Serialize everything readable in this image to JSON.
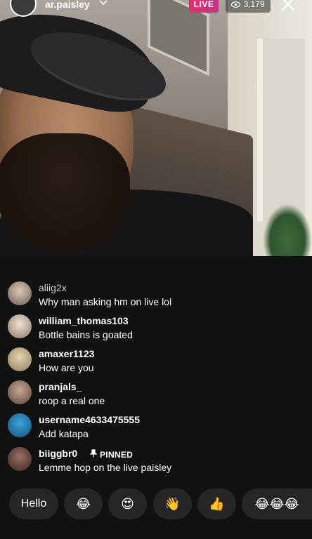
{
  "header": {
    "host_username": "ar.paisley",
    "live_label": "LIVE",
    "viewer_count": "3,179"
  },
  "comments": [
    {
      "username": "aliig2x",
      "text": "Why man asking hm on live lol",
      "pinned": false
    },
    {
      "username": "william_thomas103",
      "text": "Bottle bains is goated",
      "pinned": false
    },
    {
      "username": "amaxer1123",
      "text": "How are you",
      "pinned": false
    },
    {
      "username": "pranjals_",
      "text": "roop a real one",
      "pinned": false
    },
    {
      "username": "username4633475555",
      "text": "Add katapa",
      "pinned": false
    },
    {
      "username": "biiggbr0",
      "text": "Lemme hop on the live paisley",
      "pinned": true,
      "pinned_label": "PINNED"
    }
  ],
  "quick_reactions": {
    "text_chip": "Hello",
    "emoji_chips": [
      "😂",
      "😍",
      "👋",
      "👍",
      "😂😂😂"
    ]
  },
  "colors": {
    "live_gradient_start": "#e1306c",
    "live_gradient_end": "#c13584",
    "chip_bg": "#262626",
    "page_bg": "#111111"
  },
  "icons": [
    "eye-icon",
    "close-icon",
    "chevron-down-icon",
    "pin-icon"
  ]
}
